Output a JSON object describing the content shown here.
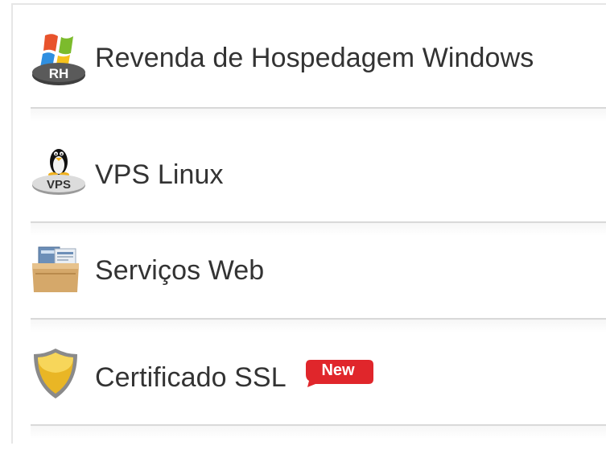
{
  "menu": {
    "items": [
      {
        "label": "Revenda de Hospedagem Windows",
        "icon": "windows-reseller-icon",
        "icon_text": "RH"
      },
      {
        "label": "VPS Linux",
        "icon": "linux-vps-icon",
        "icon_text": "VPS"
      },
      {
        "label": "Serviços Web",
        "icon": "web-services-box-icon"
      },
      {
        "label": "Certificado SSL",
        "icon": "ssl-shield-icon",
        "badge": "New"
      }
    ]
  },
  "colors": {
    "text": "#333333",
    "divider": "#d9d9d9",
    "badge": "#e0262b",
    "shield_gold": "#e9b625"
  }
}
